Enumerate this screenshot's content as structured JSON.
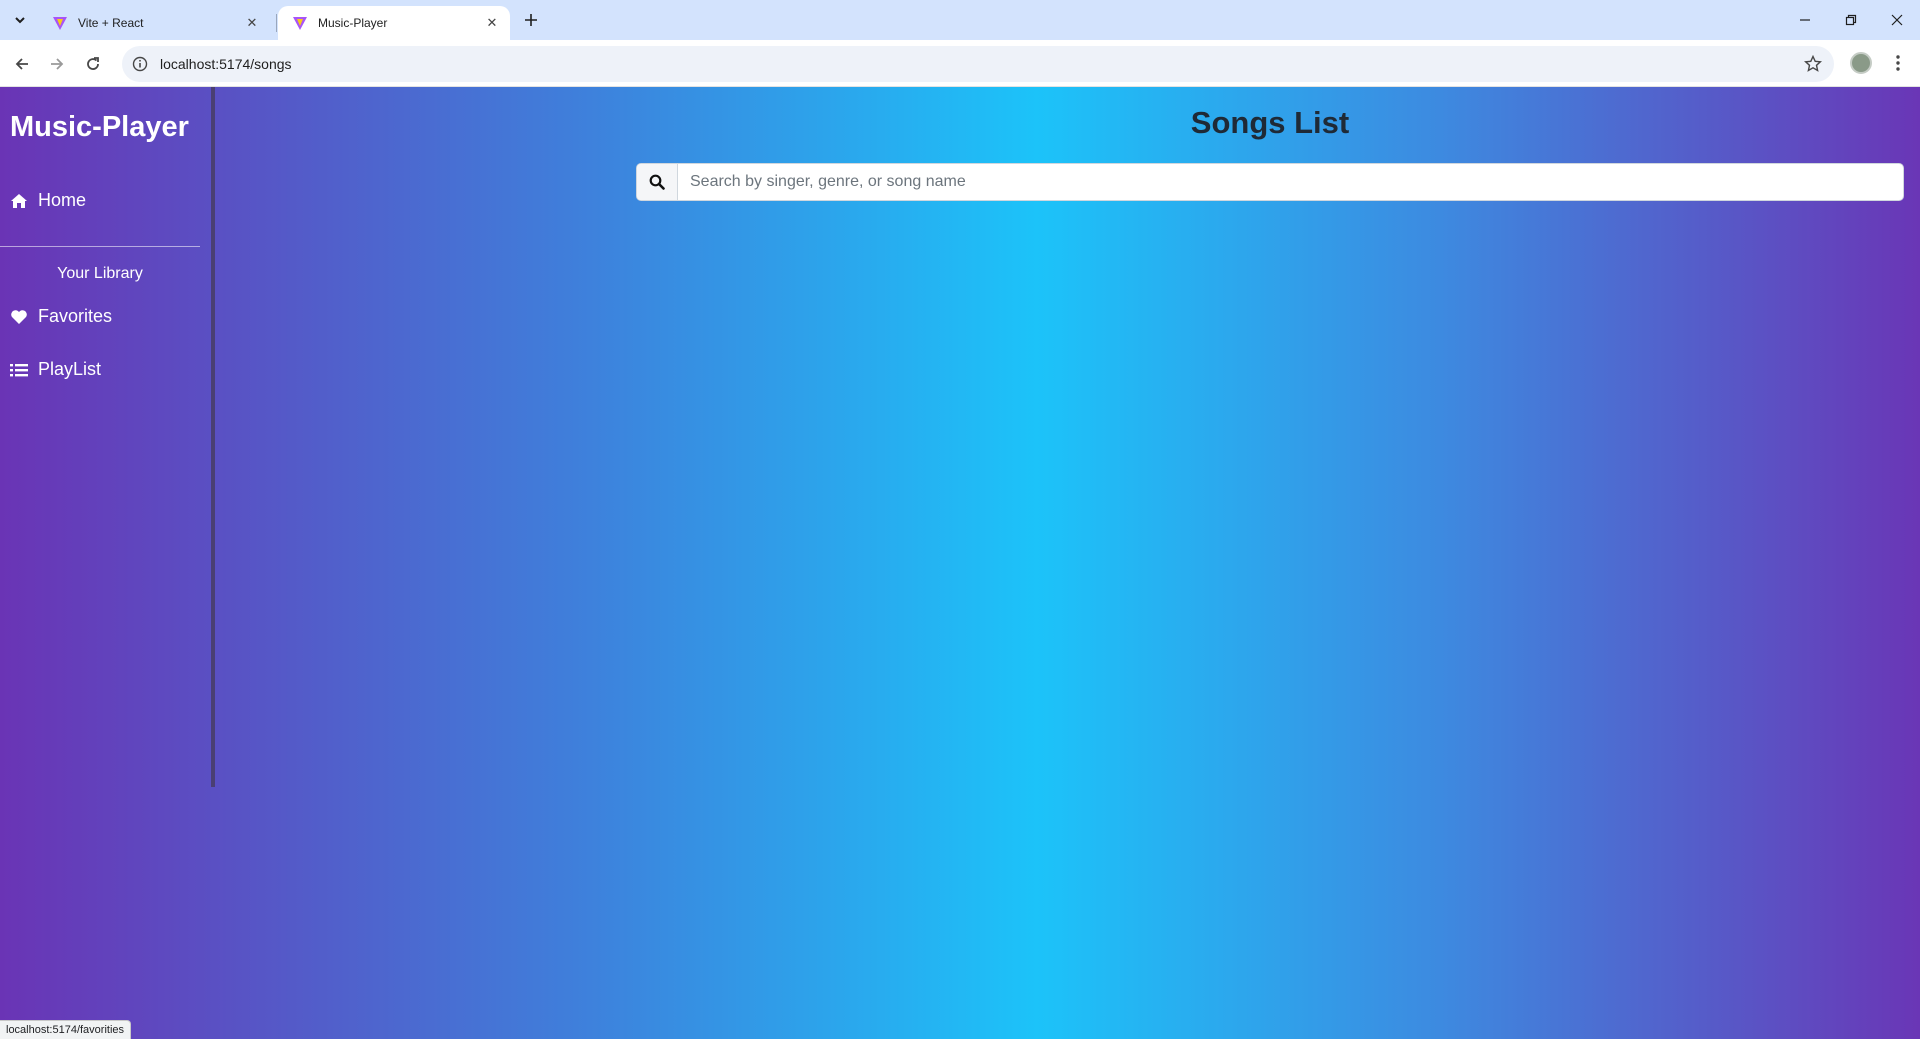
{
  "browser": {
    "tabs": [
      {
        "title": "Vite + React",
        "active": false
      },
      {
        "title": "Music-Player",
        "active": true
      }
    ],
    "url": "localhost:5174/songs",
    "status_url": "localhost:5174/favorities"
  },
  "sidebar": {
    "brand": "Music-Player",
    "home_label": "Home",
    "library_label": "Your Library",
    "favorites_label": "Favorites",
    "playlist_label": "PlayList"
  },
  "main": {
    "title": "Songs List",
    "search": {
      "placeholder": "Search by singer, genre, or song name",
      "value": ""
    }
  },
  "colors": {
    "gradient_edge": "#6a34b5",
    "gradient_center": "#1cc3f9",
    "title_text": "#1f2a36"
  }
}
